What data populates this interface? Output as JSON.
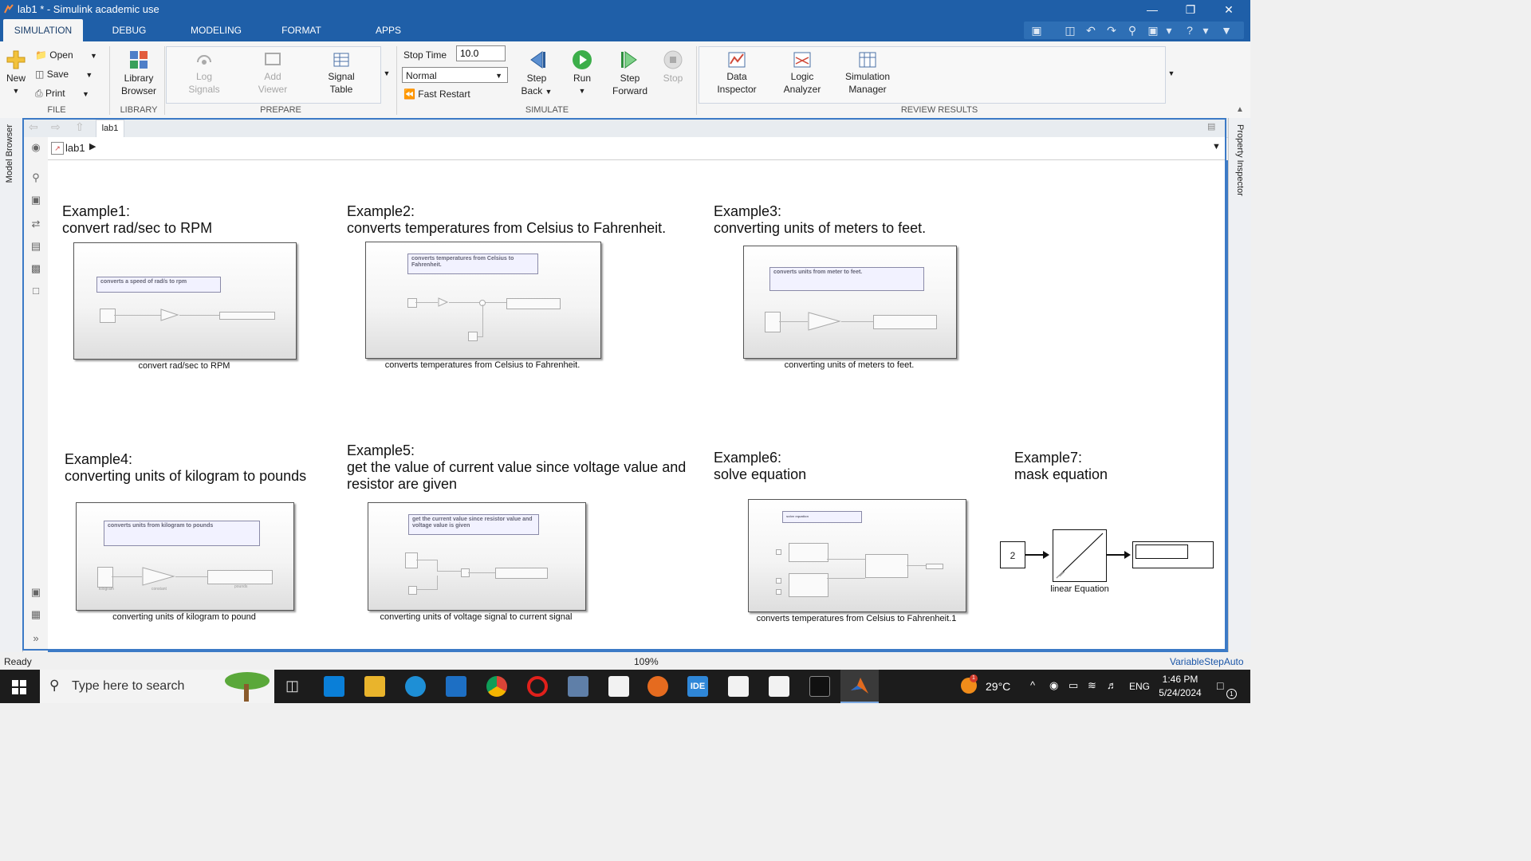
{
  "window": {
    "title": "lab1 * - Simulink academic use"
  },
  "tabs": [
    {
      "label": "SIMULATION",
      "active": true
    },
    {
      "label": "DEBUG"
    },
    {
      "label": "MODELING"
    },
    {
      "label": "FORMAT"
    },
    {
      "label": "APPS"
    }
  ],
  "toolstrip": {
    "file": {
      "new": "New",
      "open": "Open",
      "save": "Save",
      "print": "Print",
      "section": "FILE"
    },
    "library": {
      "button": "Library Browser",
      "line1": "Library",
      "line2": "Browser",
      "section": "LIBRARY"
    },
    "prepare": {
      "log1": "Log",
      "log2": "Signals",
      "add1": "Add",
      "add2": "Viewer",
      "sig1": "Signal",
      "sig2": "Table",
      "section": "PREPARE"
    },
    "simulate": {
      "stop_time_label": "Stop Time",
      "stop_time_value": "10.0",
      "mode": "Normal",
      "fast_restart": "Fast Restart",
      "stepback1": "Step",
      "stepback2": "Back",
      "run": "Run",
      "stepfwd1": "Step",
      "stepfwd2": "Forward",
      "stop": "Stop",
      "section": "SIMULATE"
    },
    "review": {
      "di1": "Data",
      "di2": "Inspector",
      "la1": "Logic",
      "la2": "Analyzer",
      "sm1": "Simulation",
      "sm2": "Manager",
      "section": "REVIEW RESULTS"
    }
  },
  "side": {
    "left": "Model Browser",
    "right": "Property Inspector"
  },
  "editor": {
    "tab": "lab1",
    "breadcrumb": "lab1"
  },
  "examples": [
    {
      "title1": "Example1:",
      "title2": "convert rad/sec to RPM",
      "annotation": "converts a speed of rad/s to rpm",
      "caption": "convert rad/sec to RPM"
    },
    {
      "title1": "Example2:",
      "title2": "converts temperatures from Celsius to Fahrenheit.",
      "annotation": "converts temperatures from Celsius to Fahrenheit.",
      "caption": "converts temperatures from Celsius to Fahrenheit."
    },
    {
      "title1": "Example3:",
      "title2": "converting units of meters to feet.",
      "annotation": "converts units from meter to feet.",
      "caption": "converting units of meters to feet."
    },
    {
      "title1": "Example4:",
      "title2": "converting units of kilogram to pounds",
      "annotation": "converts units from kilogram to pounds",
      "caption": "converting units of kilogram to pound",
      "labels": [
        "kilogram",
        "constant",
        "pounds"
      ]
    },
    {
      "title1": "Example5:",
      "title2": "get the value of current value since voltage value and",
      "title3": "resistor are given",
      "annotation": "get the current value since resistor value and voltage value is given",
      "caption": "converting units of voltage signal to current signal"
    },
    {
      "title1": "Example6:",
      "title2": "solve equation",
      "annotation": "solve equation",
      "caption": "converts temperatures from Celsius to Fahrenheit.1"
    },
    {
      "title1": "Example7:",
      "title2": "mask equation",
      "constant": "2",
      "caption": "linear Equation"
    }
  ],
  "status": {
    "left": "Ready",
    "zoom": "109%",
    "solver": "VariableStepAuto"
  },
  "taskbar": {
    "search_placeholder": "Type here to search",
    "weather": "29°C",
    "lang": "ENG",
    "time": "1:46 PM",
    "date": "5/24/2024",
    "notif_count": "1",
    "weather_badge": "1"
  }
}
